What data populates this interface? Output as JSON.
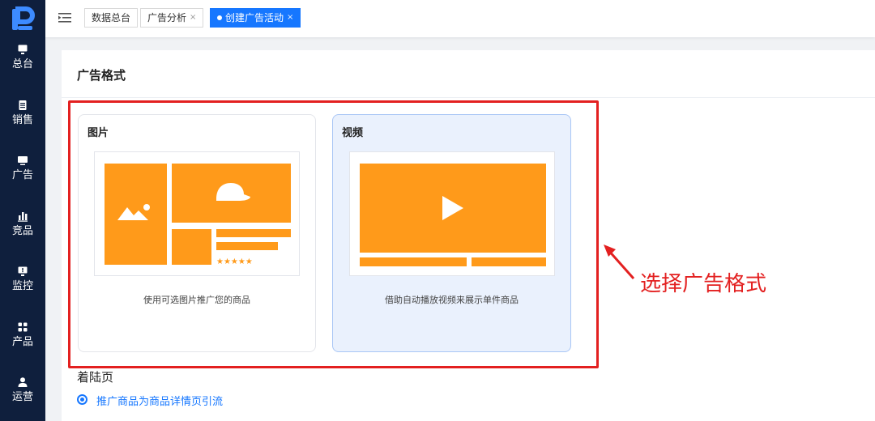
{
  "sidebar": {
    "items": [
      {
        "label": "总台",
        "icon": "monitor-icon"
      },
      {
        "label": "销售",
        "icon": "document-icon"
      },
      {
        "label": "广告",
        "icon": "ad-icon"
      },
      {
        "label": "竞品",
        "icon": "bar-chart-icon"
      },
      {
        "label": "监控",
        "icon": "monitor-alert-icon"
      },
      {
        "label": "产品",
        "icon": "grid-icon"
      },
      {
        "label": "运营",
        "icon": "user-icon"
      }
    ]
  },
  "tabs": [
    {
      "label": "数据总台",
      "closable": false
    },
    {
      "label": "广告分析",
      "closable": true,
      "close": "×"
    },
    {
      "label": "创建广告活动",
      "closable": true,
      "close": "×",
      "active": true
    }
  ],
  "section": {
    "title": "广告格式"
  },
  "cards": [
    {
      "title": "图片",
      "description": "使用可选图片推广您的商品",
      "selected": false
    },
    {
      "title": "视频",
      "description": "借助自动播放视频来展示单件商品",
      "selected": true
    }
  ],
  "annotation": {
    "text": "选择广告格式"
  },
  "landing": {
    "label": "着陆页",
    "option": "推广商品为商品详情页引流"
  },
  "colors": {
    "accent": "#1677ff",
    "sidebar": "#0f1f3d",
    "illustration": "#ff9a1a",
    "annotation": "#e32020",
    "selected_card_bg": "#eaf1fd"
  }
}
